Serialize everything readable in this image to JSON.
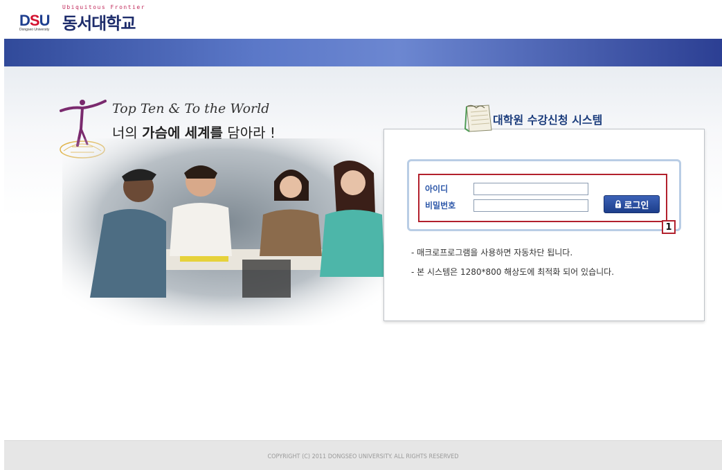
{
  "header": {
    "logo_tagline": "Ubiquitous Frontier",
    "logo_mark": "DSU",
    "logo_subtitle": "Dongseo University",
    "logo_name": "동서대학교"
  },
  "slogan": {
    "line1": "Top Ten & To the World",
    "line2_prefix": "너의 ",
    "line2_bold1": "가슴에",
    "line2_mid": " ",
    "line2_bold2": "세계를",
    "line2_suffix": " 담아라 !"
  },
  "login": {
    "title": "대학원 수강신청 시스템",
    "id_label": "아이디",
    "pw_label": "비밀번호",
    "id_value": "",
    "pw_value": "",
    "button_label": "로그인",
    "marker": "1"
  },
  "notices": [
    "- 매크로프로그램을 사용하면 자동차단 됩니다.",
    "- 본 시스템은 1280*800 해상도에 최적화 되어 있습니다."
  ],
  "footer": {
    "copyright": "COPYRIGHT (C) 2011 DONGSEO UNIVERSITY. ALL RIGHTS RESERVED"
  },
  "colors": {
    "topbar": "#4a65b8",
    "accent_red": "#b2202c",
    "title_blue": "#1b3c7c",
    "button_blue": "#1d3e8b"
  }
}
